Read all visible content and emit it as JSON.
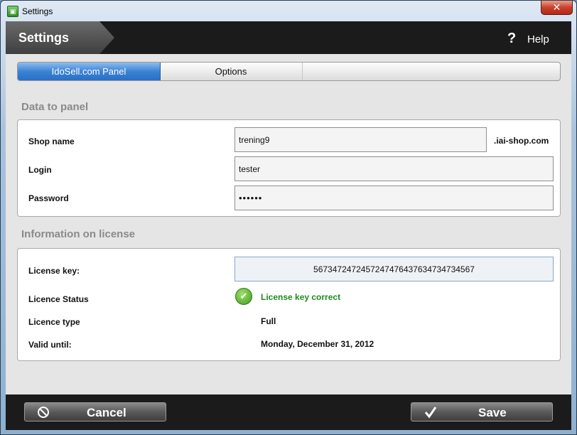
{
  "window": {
    "title": "Settings",
    "close_glyph": "✕",
    "app_icon": "green-app-icon"
  },
  "header": {
    "title": "Settings",
    "help_icon": "?",
    "help_label": "Help"
  },
  "tabs": [
    {
      "label": "IdoSell.com Panel",
      "active": true
    },
    {
      "label": "Options",
      "active": false
    }
  ],
  "panel": {
    "section_title": "Data to panel",
    "shop_name_label": "Shop name",
    "shop_name_value": "trening9",
    "shop_suffix": ".iai-shop.com",
    "login_label": "Login",
    "login_value": "tester",
    "password_label": "Password",
    "password_value": "••••••"
  },
  "license": {
    "section_title": "Information on license",
    "key_label": "License key:",
    "key_value": "5673472472457247476437634734734567",
    "status_label": "Licence Status",
    "status_text": "License key correct",
    "status_color": "#1f8a1f",
    "type_label": "Licence type",
    "type_value": "Full",
    "valid_label": "Valid until:",
    "valid_value": "Monday, December 31, 2012"
  },
  "footer": {
    "cancel_label": "Cancel",
    "save_label": "Save"
  }
}
